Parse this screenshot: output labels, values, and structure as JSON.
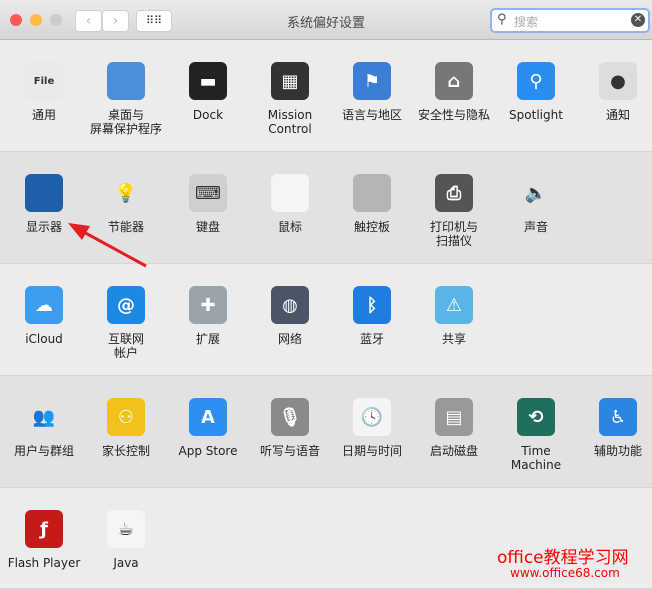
{
  "window": {
    "title": "系统偏好设置",
    "search_placeholder": "搜索"
  },
  "rows": [
    [
      {
        "label": "通用",
        "icon": "general-icon",
        "color": "#e9e9e9",
        "glyph": "File"
      },
      {
        "label": "桌面与\n屏幕保护程序",
        "icon": "desktop-icon",
        "color": "#4a90d9",
        "glyph": ""
      },
      {
        "label": "Dock",
        "icon": "dock-icon",
        "color": "#222",
        "glyph": "▬"
      },
      {
        "label": "Mission\nControl",
        "icon": "mission-control-icon",
        "color": "#333",
        "glyph": "▦"
      },
      {
        "label": "语言与地区",
        "icon": "language-icon",
        "color": "#3a7fd5",
        "glyph": "⚑"
      },
      {
        "label": "安全性与隐私",
        "icon": "security-icon",
        "color": "#777",
        "glyph": "⌂"
      },
      {
        "label": "Spotlight",
        "icon": "spotlight-icon",
        "color": "#2a8ef0",
        "glyph": "⚲"
      },
      {
        "label": "通知",
        "icon": "notifications-icon",
        "color": "#ddd",
        "glyph": "●"
      }
    ],
    [
      {
        "label": "显示器",
        "icon": "displays-icon",
        "color": "#1d5fa8",
        "glyph": ""
      },
      {
        "label": "节能器",
        "icon": "energy-saver-icon",
        "color": "transparent",
        "glyph": "💡"
      },
      {
        "label": "键盘",
        "icon": "keyboard-icon",
        "color": "#cfcfcf",
        "glyph": "⌨"
      },
      {
        "label": "鼠标",
        "icon": "mouse-icon",
        "color": "#f5f5f5",
        "glyph": ""
      },
      {
        "label": "触控板",
        "icon": "trackpad-icon",
        "color": "#b5b5b5",
        "glyph": ""
      },
      {
        "label": "打印机与\n扫描仪",
        "icon": "printers-icon",
        "color": "#555",
        "glyph": "⎙"
      },
      {
        "label": "声音",
        "icon": "sound-icon",
        "color": "transparent",
        "glyph": "🔈"
      }
    ],
    [
      {
        "label": "iCloud",
        "icon": "icloud-icon",
        "color": "#3b9cf0",
        "glyph": "☁"
      },
      {
        "label": "互联网\n帐户",
        "icon": "internet-accounts-icon",
        "color": "#1e88e5",
        "glyph": "@"
      },
      {
        "label": "扩展",
        "icon": "extensions-icon",
        "color": "#9aa4a8",
        "glyph": "✚"
      },
      {
        "label": "网络",
        "icon": "network-icon",
        "color": "#4a5568",
        "glyph": "◍"
      },
      {
        "label": "蓝牙",
        "icon": "bluetooth-icon",
        "color": "#1f7de0",
        "glyph": "ᛒ"
      },
      {
        "label": "共享",
        "icon": "sharing-icon",
        "color": "#5ab4e8",
        "glyph": "⚠"
      }
    ],
    [
      {
        "label": "用户与群组",
        "icon": "users-groups-icon",
        "color": "transparent",
        "glyph": "👥"
      },
      {
        "label": "家长控制",
        "icon": "parental-controls-icon",
        "color": "#f2c21b",
        "glyph": "⚇"
      },
      {
        "label": "App Store",
        "icon": "app-store-icon",
        "color": "#2d8ff0",
        "glyph": "A"
      },
      {
        "label": "听写与语音",
        "icon": "dictation-icon",
        "color": "#8a8a8a",
        "glyph": "🎙"
      },
      {
        "label": "日期与时间",
        "icon": "date-time-icon",
        "color": "#f4f4f4",
        "glyph": "🕓"
      },
      {
        "label": "启动磁盘",
        "icon": "startup-disk-icon",
        "color": "#999",
        "glyph": "▤"
      },
      {
        "label": "Time Machine",
        "icon": "time-machine-icon",
        "color": "#1f6e5e",
        "glyph": "⟲"
      },
      {
        "label": "辅助功能",
        "icon": "accessibility-icon",
        "color": "#2a86e0",
        "glyph": "♿"
      }
    ],
    [
      {
        "label": "Flash Player",
        "icon": "flash-player-icon",
        "color": "#c41a1a",
        "glyph": "ƒ"
      },
      {
        "label": "Java",
        "icon": "java-icon",
        "color": "#f5f5f5",
        "glyph": "☕"
      }
    ]
  ],
  "watermark": {
    "line1": "office教程学习网",
    "line2": "www.office68.com"
  }
}
